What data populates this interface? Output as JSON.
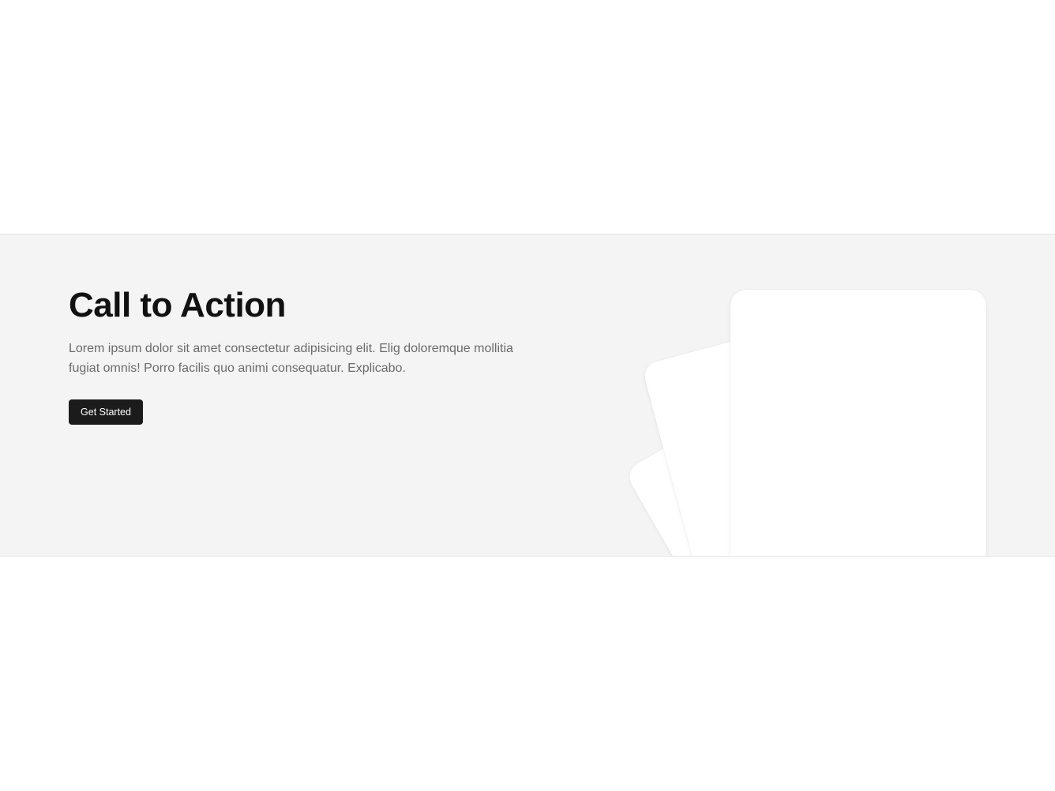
{
  "cta": {
    "title": "Call to Action",
    "description": "Lorem ipsum dolor sit amet consectetur adipisicing elit. Elig doloremque mollitia fugiat omnis! Porro facilis quo animi consequatur. Explicabo.",
    "button_label": "Get Started"
  },
  "colors": {
    "section_background": "#f4f4f4",
    "page_background": "#ffffff",
    "button_background": "#1b1b1b",
    "button_text": "#ffffff",
    "title_text": "#111111",
    "description_text": "#6b6b6b",
    "card_background": "#ffffff"
  }
}
